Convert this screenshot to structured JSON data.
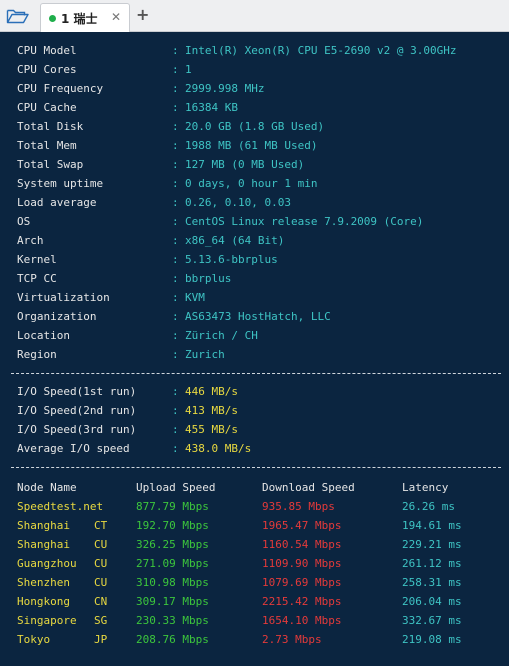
{
  "tabbar": {
    "tab_label": "1 瑞士",
    "close_glyph": "✕",
    "add_glyph": "+"
  },
  "sysinfo": [
    {
      "key": "CPU Model",
      "value": "Intel(R) Xeon(R) CPU E5-2690 v2 @ 3.00GHz"
    },
    {
      "key": "CPU Cores",
      "value": "1"
    },
    {
      "key": "CPU Frequency",
      "value": "2999.998 MHz"
    },
    {
      "key": "CPU Cache",
      "value": "16384 KB"
    },
    {
      "key": "Total Disk",
      "value": "20.0 GB (1.8 GB Used)"
    },
    {
      "key": "Total Mem",
      "value": "1988 MB (61 MB Used)"
    },
    {
      "key": "Total Swap",
      "value": "127 MB (0 MB Used)"
    },
    {
      "key": "System uptime",
      "value": "0 days, 0 hour 1 min"
    },
    {
      "key": "Load average",
      "value": "0.26, 0.10, 0.03"
    },
    {
      "key": "OS",
      "value": "CentOS Linux release 7.9.2009 (Core)"
    },
    {
      "key": "Arch",
      "value": "x86_64 (64 Bit)"
    },
    {
      "key": "Kernel",
      "value": "5.13.6-bbrplus"
    },
    {
      "key": "TCP CC",
      "value": "bbrplus"
    },
    {
      "key": "Virtualization",
      "value": "KVM"
    },
    {
      "key": "Organization",
      "value": "AS63473 HostHatch, LLC"
    },
    {
      "key": "Location",
      "value": "Zürich / CH"
    },
    {
      "key": "Region",
      "value": "Zurich"
    }
  ],
  "separator": ":",
  "io": [
    {
      "key": "I/O Speed(1st run)",
      "value": "446 MB/s"
    },
    {
      "key": "I/O Speed(2nd run)",
      "value": "413 MB/s"
    },
    {
      "key": "I/O Speed(3rd run)",
      "value": "455 MB/s"
    },
    {
      "key": "Average I/O speed",
      "value": "438.0 MB/s"
    }
  ],
  "speedtest": {
    "headers": {
      "node": "Node Name",
      "upload": "Upload Speed",
      "download": "Download Speed",
      "latency": "Latency"
    },
    "rows": [
      {
        "name": "Speedtest.net",
        "cc": "",
        "upload": "877.79 Mbps",
        "download": "935.85 Mbps",
        "latency": "26.26 ms"
      },
      {
        "name": "Shanghai",
        "cc": "CT",
        "upload": "192.70 Mbps",
        "download": "1965.47 Mbps",
        "latency": "194.61 ms"
      },
      {
        "name": "Shanghai",
        "cc": "CU",
        "upload": "326.25 Mbps",
        "download": "1160.54 Mbps",
        "latency": "229.21 ms"
      },
      {
        "name": "Guangzhou",
        "cc": "CU",
        "upload": "271.09 Mbps",
        "download": "1109.90 Mbps",
        "latency": "261.12 ms"
      },
      {
        "name": "Shenzhen",
        "cc": "CU",
        "upload": "310.98 Mbps",
        "download": "1079.69 Mbps",
        "latency": "258.31 ms"
      },
      {
        "name": "Hongkong",
        "cc": "CN",
        "upload": "309.17 Mbps",
        "download": "2215.42 Mbps",
        "latency": "206.04 ms"
      },
      {
        "name": "Singapore",
        "cc": "SG",
        "upload": "230.33 Mbps",
        "download": "1654.10 Mbps",
        "latency": "332.67 ms"
      },
      {
        "name": "Tokyo",
        "cc": "JP",
        "upload": "208.76 Mbps",
        "download": "2.73 Mbps",
        "latency": "219.08 ms"
      }
    ]
  },
  "colors": {
    "background": "#0b2540",
    "key": "#e6e6e6",
    "value": "#3ec4c4",
    "io_value": "#e8d940",
    "node": "#e8d940",
    "upload": "#3cc63c",
    "download": "#e43a3a",
    "latency": "#3ec4c4",
    "status_dot": "#1fae4b"
  }
}
